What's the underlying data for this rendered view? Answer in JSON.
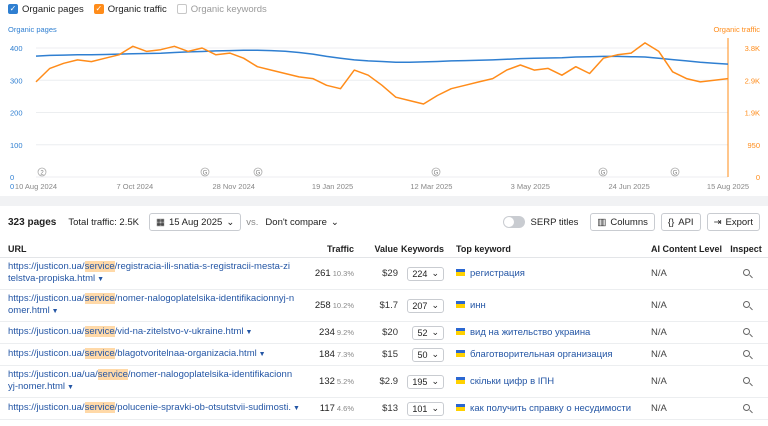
{
  "legend": {
    "organic_pages": "Organic pages",
    "organic_traffic": "Organic traffic",
    "organic_keywords": "Organic keywords"
  },
  "chart_data": {
    "type": "line",
    "left_axis_label": "Organic pages",
    "right_axis_label": "Organic traffic",
    "left_ticks": [
      "400",
      "300",
      "200",
      "100",
      "0"
    ],
    "right_ticks": [
      "3.8K",
      "2.9K",
      "1.9K",
      "950",
      "0"
    ],
    "x_ticks": [
      "10 Aug 2024",
      "7 Oct 2024",
      "28 Nov 2024",
      "19 Jan 2025",
      "12 Mar 2025",
      "3 May 2025",
      "24 Jun 2025",
      "15 Aug 2025"
    ],
    "annotation_markers": [
      "2",
      "G",
      "G",
      "G",
      "G",
      "G"
    ],
    "ylim_left": [
      0,
      400
    ],
    "ylim_right": [
      0,
      3800
    ],
    "series": [
      {
        "name": "Organic pages",
        "color": "#2f7fd1",
        "values": [
          375,
          377,
          378,
          379,
          379,
          380,
          381,
          382,
          383,
          384,
          386,
          388,
          389,
          391,
          392,
          393,
          393,
          392,
          390,
          386,
          381,
          374,
          368,
          363,
          360,
          358,
          356,
          356,
          357,
          358,
          360,
          361,
          362,
          363,
          365,
          367,
          368,
          369,
          370,
          372,
          373,
          374,
          374,
          373,
          372,
          368,
          364,
          360,
          356,
          353,
          350
        ]
      },
      {
        "name": "Organic traffic",
        "color": "#ff8c1a",
        "values": [
          2800,
          3200,
          3350,
          3450,
          3400,
          3500,
          3600,
          3850,
          3700,
          3750,
          3850,
          3700,
          3800,
          3600,
          3650,
          3500,
          3250,
          3150,
          3050,
          2950,
          2900,
          2700,
          2600,
          3150,
          3000,
          2700,
          2350,
          2250,
          2150,
          2400,
          2600,
          2700,
          2800,
          2900,
          3150,
          3300,
          3150,
          3200,
          3000,
          3250,
          3050,
          3500,
          3600,
          3650,
          3950,
          3700,
          3100,
          2900,
          2800,
          2850,
          2900
        ]
      }
    ]
  },
  "toolbar": {
    "pages": "323 pages",
    "total_traffic": "Total traffic: 2.5K",
    "date": "15 Aug 2025",
    "vs": "vs.",
    "compare": "Don't compare",
    "serp_titles": "SERP titles",
    "columns": "Columns",
    "api": "API",
    "export": "Export"
  },
  "table": {
    "headers": {
      "url": "URL",
      "traffic": "Traffic",
      "value": "Value",
      "keywords": "Keywords",
      "top_keyword": "Top keyword",
      "ai": "AI Content Level",
      "inspect": "Inspect"
    },
    "rows": [
      {
        "url_pre": "https://justicon.ua/",
        "url_hl": "service",
        "url_post": "/registracia-ili-snatia-s-registracii-mesta-zi",
        "url_line2": "telstva-propiska.html",
        "traffic": "261",
        "pct": "10.3%",
        "value": "$29",
        "keywords": "224",
        "top": "регистрация",
        "ai": "N/A"
      },
      {
        "url_pre": "https://justicon.ua/",
        "url_hl": "service",
        "url_post": "/nomer-nalogoplatelsika-identifikacionnyj-n",
        "url_line2": "omer.html",
        "traffic": "258",
        "pct": "10.2%",
        "value": "$1.7",
        "keywords": "207",
        "top": "инн",
        "ai": "N/A"
      },
      {
        "url_pre": "https://justicon.ua/",
        "url_hl": "service",
        "url_post": "/vid-na-zitelstvo-v-ukraine.html",
        "url_line2": "",
        "traffic": "234",
        "pct": "9.2%",
        "value": "$20",
        "keywords": "52",
        "top": "вид на жительство украина",
        "ai": "N/A"
      },
      {
        "url_pre": "https://justicon.ua/",
        "url_hl": "service",
        "url_post": "/blagotvoritelnaa-organizacia.html",
        "url_line2": "",
        "traffic": "184",
        "pct": "7.3%",
        "value": "$15",
        "keywords": "50",
        "top": "благотворительная организация",
        "ai": "N/A"
      },
      {
        "url_pre": "https://justicon.ua/ua/",
        "url_hl": "service",
        "url_post": "/nomer-nalogoplatelsika-identifikacionn",
        "url_line2": "yj-nomer.html",
        "traffic": "132",
        "pct": "5.2%",
        "value": "$2.9",
        "keywords": "195",
        "top": "скільки цифр в ІПН",
        "ai": "N/A"
      },
      {
        "url_pre": "https://justicon.ua/",
        "url_hl": "service",
        "url_post": "/polucenie-spravki-ob-otsutstvii-sudimosti.",
        "url_line2": "",
        "traffic": "117",
        "pct": "4.6%",
        "value": "$13",
        "keywords": "101",
        "top": "как получить справку о несудимости",
        "ai": "N/A"
      }
    ]
  }
}
